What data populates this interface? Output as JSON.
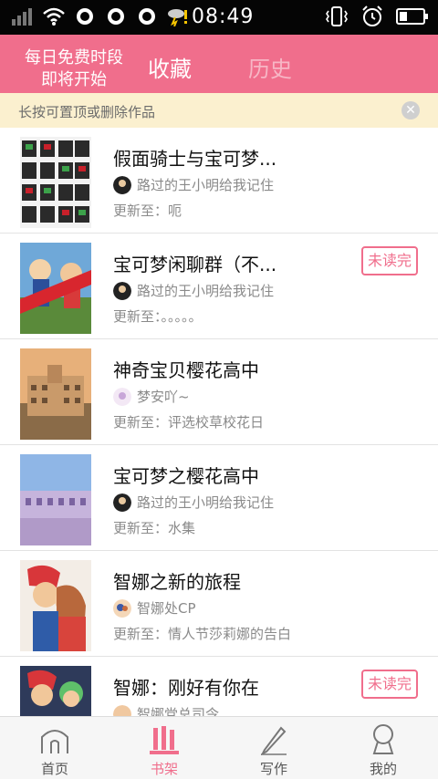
{
  "status_bar": {
    "time": "08:49"
  },
  "header": {
    "promo_line1": "每日免费时段",
    "promo_line2": "即将开始",
    "tabs": [
      {
        "label": "收藏",
        "active": true
      },
      {
        "label": "历史",
        "active": false
      }
    ]
  },
  "notice": {
    "text": "长按可置顶或删除作品"
  },
  "items": [
    {
      "title": "假面骑士与宝可梦...",
      "author": "路过的王小明给我记住",
      "update": "更新至：呃",
      "badge": ""
    },
    {
      "title": "宝可梦闲聊群（不...",
      "author": "路过的王小明给我记住",
      "update": "更新至：。。。。。",
      "badge": "未读完"
    },
    {
      "title": "神奇宝贝樱花高中",
      "author": "梦安吖~",
      "update": "更新至：评选校草校花日",
      "badge": ""
    },
    {
      "title": "宝可梦之樱花高中",
      "author": "路过的王小明给我记住",
      "update": "更新至：水集",
      "badge": ""
    },
    {
      "title": "智娜之新的旅程",
      "author": "智娜处CP",
      "update": "更新至：情人节莎莉娜的告白",
      "badge": ""
    },
    {
      "title": "智娜：刚好有你在",
      "author": "智娜党总司令",
      "update": "",
      "badge": "未读完"
    }
  ],
  "bottom_nav": [
    {
      "label": "首页",
      "icon": "home-icon",
      "active": false
    },
    {
      "label": "书架",
      "icon": "bookshelf-icon",
      "active": true
    },
    {
      "label": "写作",
      "icon": "pen-icon",
      "active": false
    },
    {
      "label": "我的",
      "icon": "profile-icon",
      "active": false
    }
  ],
  "colors": {
    "accent": "#f06e8c",
    "notice_bg": "#fbf0cf",
    "tab_inactive": "#f7b6c5"
  }
}
